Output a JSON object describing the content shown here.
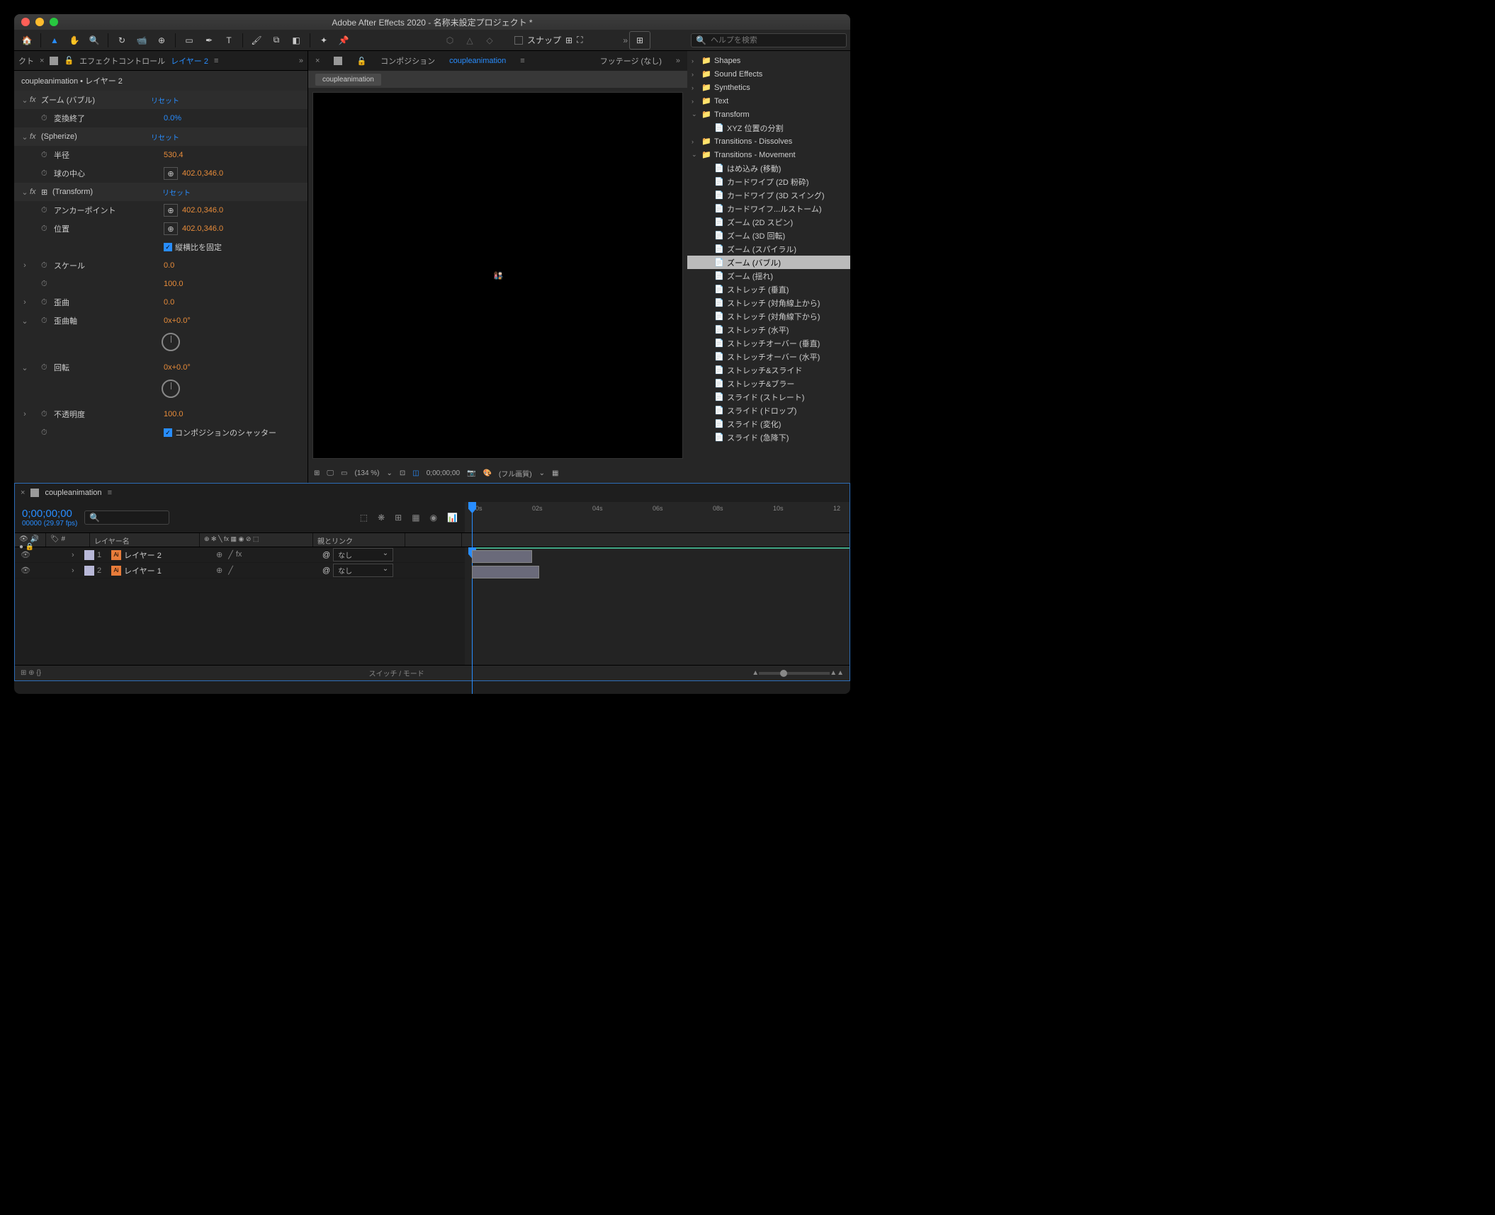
{
  "title": "Adobe After Effects 2020 - 名称未設定プロジェクト *",
  "toolbar": {
    "snap": "スナップ"
  },
  "help": {
    "placeholder": "ヘルプを検索"
  },
  "ec": {
    "tab_prefix": "クト",
    "tab_label": "エフェクトコントロール",
    "tab_layer": "レイヤー 2",
    "header": "coupleanimation • レイヤー 2",
    "effects": [
      {
        "name": "ズーム (バブル)",
        "reset": "リセット",
        "props": [
          {
            "name": "変換終了",
            "val": "0.0",
            "suffix": "%",
            "blue": true,
            "sw": true
          }
        ]
      },
      {
        "name": "(Spherize)",
        "reset": "リセット",
        "props": [
          {
            "name": "半径",
            "val": "530.4",
            "sw": true
          },
          {
            "name": "球の中心",
            "val": "402.0,346.0",
            "picker": true,
            "sw": true
          }
        ]
      },
      {
        "name": "(Transform)",
        "reset": "リセット",
        "icon": true,
        "props": [
          {
            "name": "アンカーポイント",
            "val": "402.0,346.0",
            "picker": true,
            "sw": true
          },
          {
            "name": "位置",
            "val": "402.0,346.0",
            "picker": true,
            "sw": true
          },
          {
            "name": "",
            "check": "縦横比を固定"
          },
          {
            "name": "スケール",
            "val": "0.0",
            "sw": true,
            "tw": true
          },
          {
            "name": "",
            "val": "100.0",
            "sw": true
          },
          {
            "name": "歪曲",
            "val": "0.0",
            "sw": true,
            "tw": true
          },
          {
            "name": "歪曲軸",
            "val": "0x+0.0°",
            "sw": true,
            "dial": true,
            "tw": true,
            "open": true
          },
          {
            "name": "回転",
            "val": "0x+0.0°",
            "sw": true,
            "dial": true,
            "tw": true,
            "open": true
          },
          {
            "name": "不透明度",
            "val": "100.0",
            "sw": true,
            "tw": true
          },
          {
            "name": "",
            "check": "コンポジションのシャッター",
            "sw": true
          }
        ]
      }
    ]
  },
  "comp": {
    "tab": "コンポジション",
    "name": "coupleanimation",
    "footage": "フッテージ (なし)",
    "subtab": "coupleanimation",
    "zoom": "(134 %)",
    "time": "0;00;00;00",
    "quality": "(フル画質)"
  },
  "tree": {
    "items": [
      {
        "l": 0,
        "t": "f",
        "n": "Shapes",
        "tw": "›"
      },
      {
        "l": 0,
        "t": "f",
        "n": "Sound Effects",
        "tw": "›"
      },
      {
        "l": 0,
        "t": "f",
        "n": "Synthetics",
        "tw": "›"
      },
      {
        "l": 0,
        "t": "f",
        "n": "Text",
        "tw": "›"
      },
      {
        "l": 0,
        "t": "f",
        "n": "Transform",
        "tw": "⌄"
      },
      {
        "l": 1,
        "t": "p",
        "n": "XYZ 位置の分割"
      },
      {
        "l": 0,
        "t": "f",
        "n": "Transitions - Dissolves",
        "tw": "›"
      },
      {
        "l": 0,
        "t": "f",
        "n": "Transitions - Movement",
        "tw": "⌄"
      },
      {
        "l": 1,
        "t": "p",
        "n": "はめ込み (移動)"
      },
      {
        "l": 1,
        "t": "p",
        "n": "カードワイプ (2D 粉砕)"
      },
      {
        "l": 1,
        "t": "p",
        "n": "カードワイプ (3D スイング)"
      },
      {
        "l": 1,
        "t": "p",
        "n": "カードワイフ...ルストーム)"
      },
      {
        "l": 1,
        "t": "p",
        "n": "ズーム (2D スピン)"
      },
      {
        "l": 1,
        "t": "p",
        "n": "ズーム (3D 回転)"
      },
      {
        "l": 1,
        "t": "p",
        "n": "ズーム (スパイラル)"
      },
      {
        "l": 1,
        "t": "p",
        "n": "ズーム (バブル)",
        "sel": true
      },
      {
        "l": 1,
        "t": "p",
        "n": "ズーム (揺れ)"
      },
      {
        "l": 1,
        "t": "p",
        "n": "ストレッチ (垂直)"
      },
      {
        "l": 1,
        "t": "p",
        "n": "ストレッチ (対角線上から)"
      },
      {
        "l": 1,
        "t": "p",
        "n": "ストレッチ (対角線下から)"
      },
      {
        "l": 1,
        "t": "p",
        "n": "ストレッチ (水平)"
      },
      {
        "l": 1,
        "t": "p",
        "n": "ストレッチオーバー (垂直)"
      },
      {
        "l": 1,
        "t": "p",
        "n": "ストレッチオーバー (水平)"
      },
      {
        "l": 1,
        "t": "p",
        "n": "ストレッチ&スライド"
      },
      {
        "l": 1,
        "t": "p",
        "n": "ストレッチ&ブラー"
      },
      {
        "l": 1,
        "t": "p",
        "n": "スライド (ストレート)"
      },
      {
        "l": 1,
        "t": "p",
        "n": "スライド (ドロップ)"
      },
      {
        "l": 1,
        "t": "p",
        "n": "スライド (変化)"
      },
      {
        "l": 1,
        "t": "p",
        "n": "スライド (急降下)"
      }
    ]
  },
  "timeline": {
    "tab": "coupleanimation",
    "timecode": "0;00;00;00",
    "frames": "00000 (29.97 fps)",
    "cols": {
      "name": "レイヤー名",
      "parent": "親とリンク"
    },
    "marks": [
      "00s",
      "02s",
      "04s",
      "06s",
      "08s",
      "10s",
      "12"
    ],
    "layers": [
      {
        "num": "1",
        "name": "レイヤー 2",
        "color": "#b8b8d8",
        "fx": true,
        "parent": "なし"
      },
      {
        "num": "2",
        "name": "レイヤー 1",
        "color": "#b8b8d8",
        "fx": false,
        "parent": "なし"
      }
    ],
    "footer": "スイッチ / モード"
  }
}
